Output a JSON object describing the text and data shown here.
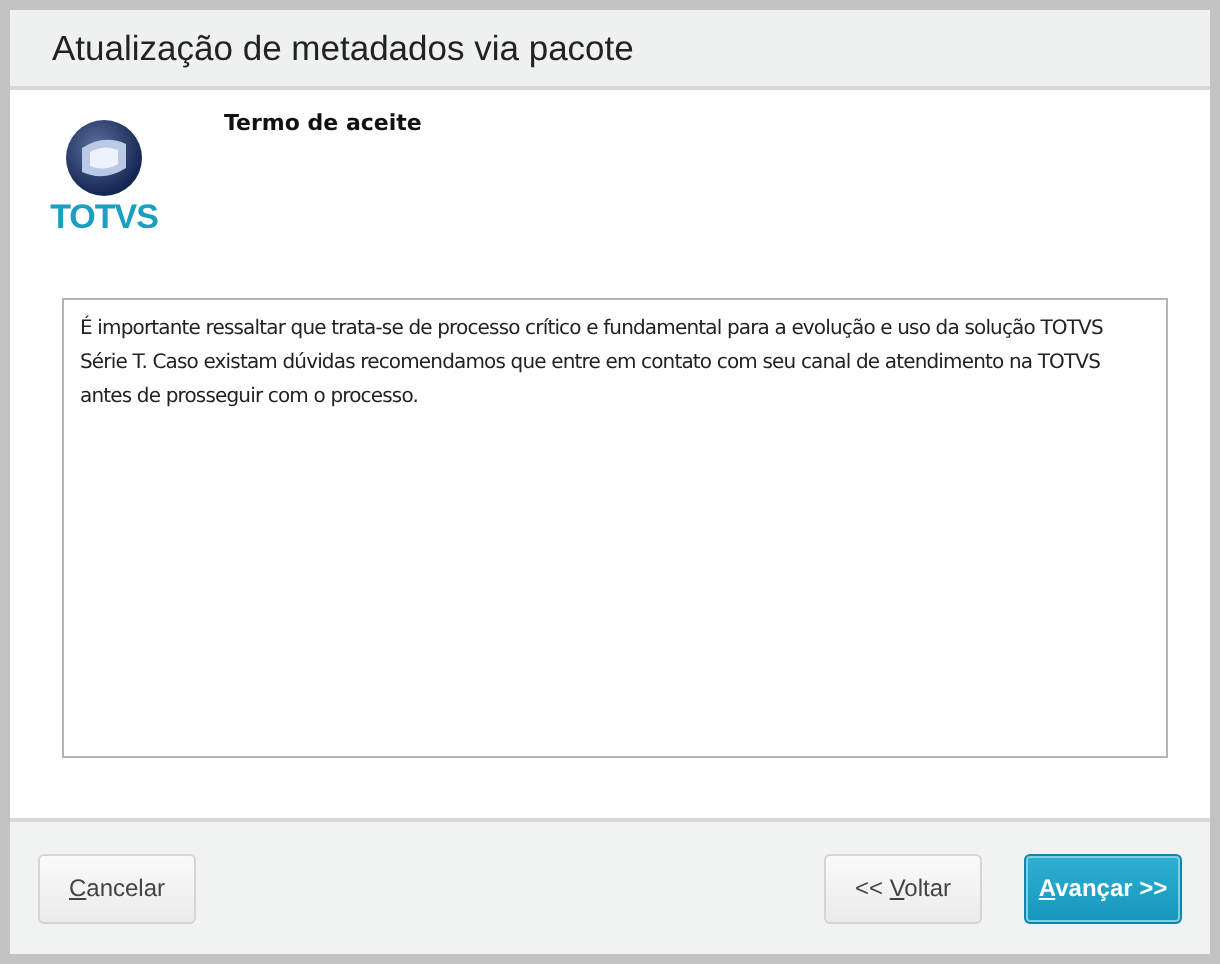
{
  "window": {
    "title": "Atualização de metadados via pacote"
  },
  "logo": {
    "text": "TOTVS"
  },
  "step": {
    "title": "Termo de aceite"
  },
  "message": {
    "value": "É importante ressaltar que trata-se de processo crítico e fundamental para a evolução e uso da solução TOTVS Série T. Caso existam dúvidas recomendamos que entre em contato com seu canal de atendimento na TOTVS antes de prosseguir com o processo."
  },
  "footer": {
    "left_buttons": [
      {
        "label": "Cancelar",
        "kind": "default"
      }
    ],
    "right_buttons": [
      {
        "label": "<< Voltar",
        "kind": "default"
      },
      {
        "label": "Avançar >>",
        "kind": "primary"
      }
    ]
  }
}
